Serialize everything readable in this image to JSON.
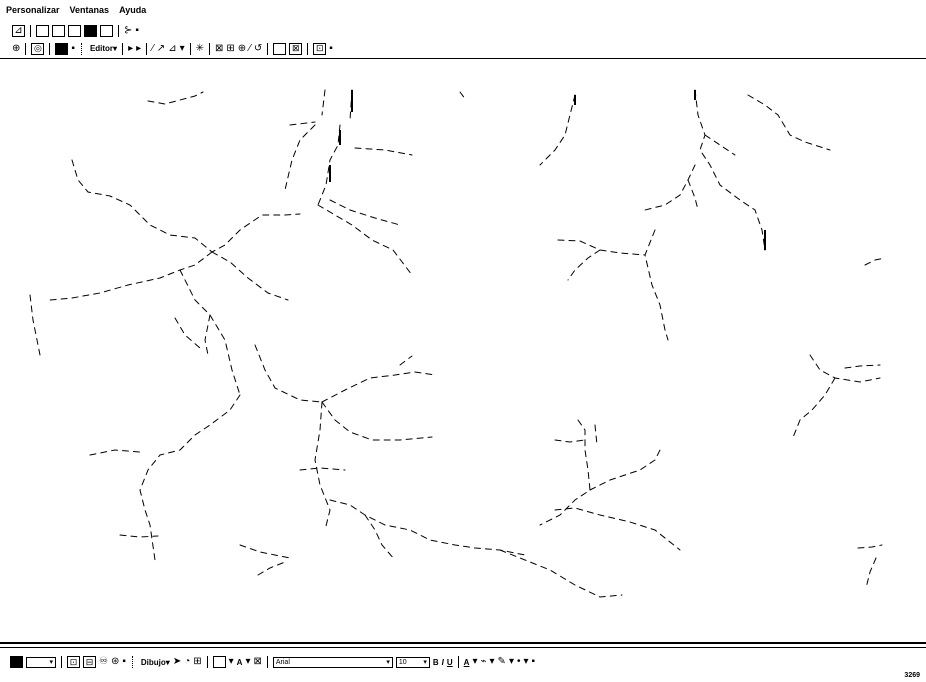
{
  "menu": {
    "items": [
      "Personalizar",
      "Ventanas",
      "Ayuda"
    ]
  },
  "toolbar2": {
    "editor_label": "Editor"
  },
  "drawing_toolbar": {
    "dibujo_label": "Dibujo",
    "font_name": "Arial",
    "font_size": "10",
    "bold": "B",
    "italic": "I",
    "underline": "U",
    "text_tool": "A"
  },
  "status_bar": {
    "coordinate": "3269"
  },
  "colors": {
    "foreground": "#000000",
    "background": "#ffffff"
  },
  "map": {
    "content": "river network line features"
  }
}
